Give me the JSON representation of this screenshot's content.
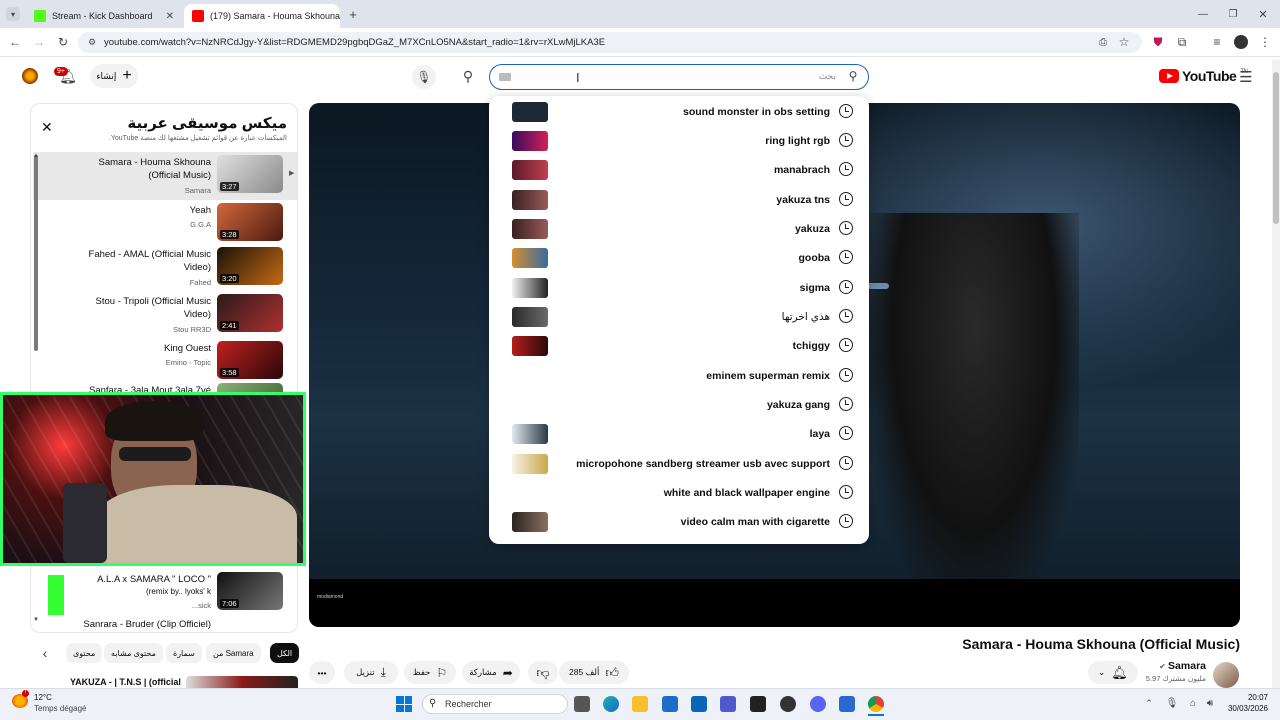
{
  "browser": {
    "tabs": [
      {
        "label": "Stream - Kick Dashboard",
        "favicon_color": "#53fc18"
      },
      {
        "label": "(179) Samara - Houma Skhouna",
        "favicon_color": "#ff0000"
      }
    ],
    "url": "youtube.com/watch?v=NzNRCdJgy-Y&list=RDGMEMD29pgbqDGaZ_M7XCnLO5NA&start_radio=1&rv=rXLwMjLKA3E"
  },
  "masthead": {
    "logo_text": "YouTube",
    "logo_region": "TN",
    "create_label": "إنشاء",
    "notification_count": "9+",
    "search_placeholder": "بحث",
    "icons": [
      "menu-icon",
      "search-icon",
      "mic-icon",
      "bell-icon",
      "plus-icon",
      "avatar"
    ]
  },
  "suggestions": [
    {
      "text": "sound monster in obs setting",
      "thumb": "#1d2a35"
    },
    {
      "text": "ring light rgb",
      "thumb": "#8a1f6b"
    },
    {
      "text": "manabrach",
      "thumb": "#8d2c3a"
    },
    {
      "text": "yakuza tns",
      "thumb": "#6d3b3b"
    },
    {
      "text": "yakuza",
      "thumb": "#6d3b3b"
    },
    {
      "text": "gooba",
      "thumb": "#4a6a8a"
    },
    {
      "text": "sigma",
      "thumb": "#e8e8e8"
    },
    {
      "text": "هذي اخرتها",
      "thumb": "#3a3a3a"
    },
    {
      "text": "tchiggy",
      "thumb": "#b51d1d"
    },
    {
      "text": "eminem superman remix",
      "thumb": ""
    },
    {
      "text": "yakuza gang",
      "thumb": ""
    },
    {
      "text": "laya",
      "thumb": "#2b3a45"
    },
    {
      "text": "micropohone sandberg streamer usb avec support",
      "thumb": "#f0e6c8"
    },
    {
      "text": "white and black wallpaper engine",
      "thumb": ""
    },
    {
      "text": "video calm man with cigarette",
      "thumb": "#5a4a3a"
    }
  ],
  "playlist": {
    "title": "ميكس موسيقى عربية",
    "subtitle": "الميكسات عبارة عن قوائم تشغيل مشتغها لك منصة YouTube.",
    "items": [
      {
        "title": "Samara - Houma Skhouna (Official Music)",
        "channel": "Samara",
        "duration": "3:27",
        "current": true,
        "thumb": "#c9c9c9"
      },
      {
        "title": "Yeah",
        "channel": "G.G.A",
        "duration": "3:28",
        "current": false,
        "thumb": "#a0402a"
      },
      {
        "title": "Fahed - AMAL (Official Music Video)",
        "channel": "Fahed",
        "duration": "3:20",
        "current": false,
        "thumb": "#3a2a1a"
      },
      {
        "title": "Stou - Tripoli (Official Music Video)",
        "channel": "Stou RR3D",
        "duration": "2:41",
        "current": false,
        "thumb": "#7a2a2a"
      },
      {
        "title": "King Ouest",
        "channel": "Emino - Topic",
        "duration": "3:58",
        "current": false,
        "thumb": "#8a2020"
      },
      {
        "title": "Sanfara - 3ala Mout 3ala 7yé",
        "channel": "",
        "duration": "",
        "current": false,
        "thumb": "#6a8a5a"
      },
      {
        "title": "A.L.A x SAMARA \" LOCO \"",
        "channel": "...sick",
        "duration": "7:06",
        "current": false,
        "thumb": "#444444"
      },
      {
        "title": "Sanrara - Bruder (Clip Officiel)",
        "channel": "",
        "duration": "",
        "current": false,
        "thumb": ""
      }
    ],
    "overlay_text": "(remix by.. lyoks' k"
  },
  "video": {
    "title": "Samara - Houma Skhouna (Official Music)",
    "watermark": "modiamond",
    "channel": "Samara",
    "subscribers": "5.97 مليون مشترك"
  },
  "chips": [
    "الكل",
    "من Samara",
    "سمارة",
    "محتوى مشابه",
    "محتوى"
  ],
  "actions": {
    "likes": "285 ألف",
    "share": "مشاركة",
    "save": "حفظ",
    "download": "تنزيل"
  },
  "next_up": {
    "title": "YAKUZA - | T.N.S | (official"
  },
  "taskbar": {
    "weather_temp": "12°C",
    "weather_desc": "Temps dégagé",
    "search_label": "Rechercher",
    "time": "20:07",
    "date": "30/03/2026"
  }
}
